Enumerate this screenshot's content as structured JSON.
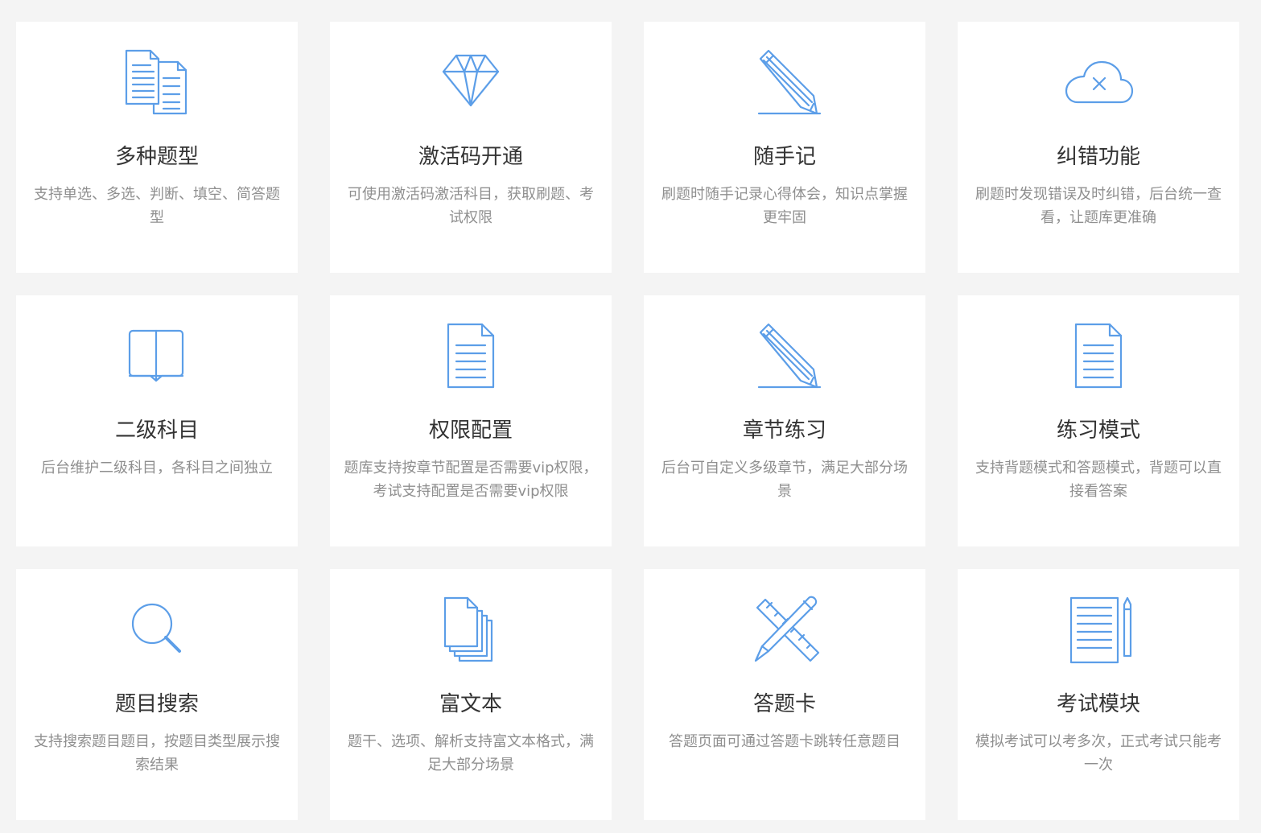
{
  "accent_color": "#5c9ee8",
  "features": [
    {
      "icon": "documents-icon",
      "title": "多种题型",
      "desc": "支持单选、多选、判断、填空、简答题型"
    },
    {
      "icon": "diamond-icon",
      "title": "激活码开通",
      "desc": "可使用激活码激活科目，获取刷题、考试权限"
    },
    {
      "icon": "pencil-icon",
      "title": "随手记",
      "desc": "刷题时随手记录心得体会，知识点掌握更牢固"
    },
    {
      "icon": "cloud-error-icon",
      "title": "纠错功能",
      "desc": "刷题时发现错误及时纠错，后台统一查看，让题库更准确"
    },
    {
      "icon": "book-icon",
      "title": "二级科目",
      "desc": "后台维护二级科目，各科目之间独立"
    },
    {
      "icon": "document-icon",
      "title": "权限配置",
      "desc": "题库支持按章节配置是否需要vip权限，考试支持配置是否需要vip权限"
    },
    {
      "icon": "pencil-icon",
      "title": "章节练习",
      "desc": "后台可自定义多级章节，满足大部分场景"
    },
    {
      "icon": "document-icon",
      "title": "练习模式",
      "desc": "支持背题模式和答题模式，背题可以直接看答案"
    },
    {
      "icon": "search-icon",
      "title": "题目搜索",
      "desc": "支持搜索题目题目，按题目类型展示搜索结果"
    },
    {
      "icon": "file-stack-icon",
      "title": "富文本",
      "desc": "题干、选项、解析支持富文本格式，满足大部分场景"
    },
    {
      "icon": "ruler-pencil-icon",
      "title": "答题卡",
      "desc": "答题页面可通过答题卡跳转任意题目"
    },
    {
      "icon": "notepad-pen-icon",
      "title": "考试模块",
      "desc": "模拟考试可以考多次，正式考试只能考一次"
    }
  ]
}
